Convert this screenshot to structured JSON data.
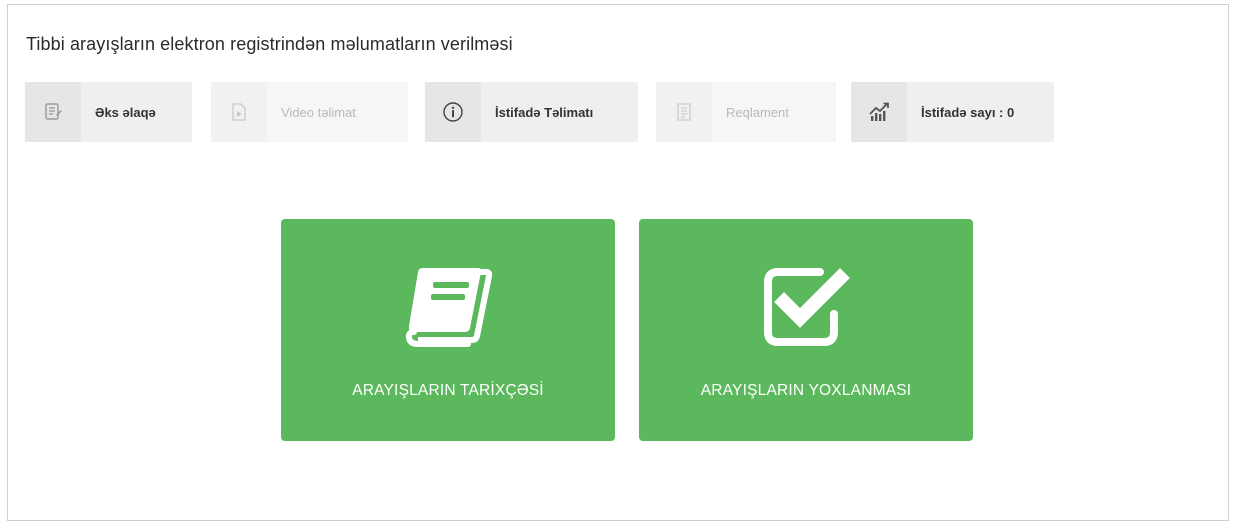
{
  "page": {
    "title": "Tibbi arayışların elektron registrindən məlumatların verilməsi"
  },
  "toolbar": {
    "items": [
      {
        "label": "Əks əlaqə",
        "icon": "feedback-icon",
        "enabled": true
      },
      {
        "label": "Video təlimat",
        "icon": "video-icon",
        "enabled": false
      },
      {
        "label": "İstifadə Təlimatı",
        "icon": "info-icon",
        "enabled": true
      },
      {
        "label": "Reqlament",
        "icon": "document-icon",
        "enabled": false
      },
      {
        "label": "İstifadə sayı : 0",
        "icon": "stats-chart-icon",
        "enabled": true
      }
    ]
  },
  "cards": [
    {
      "label": "ARAYIŞLARIN TARİXÇƏSİ",
      "icon": "book-icon"
    },
    {
      "label": "ARAYIŞLARIN YOXLANMASI",
      "icon": "checkbox-icon"
    }
  ],
  "colors": {
    "card_green": "#5cb85c",
    "toolbar_bg": "#efefef",
    "title_text": "#2b2b2b"
  }
}
